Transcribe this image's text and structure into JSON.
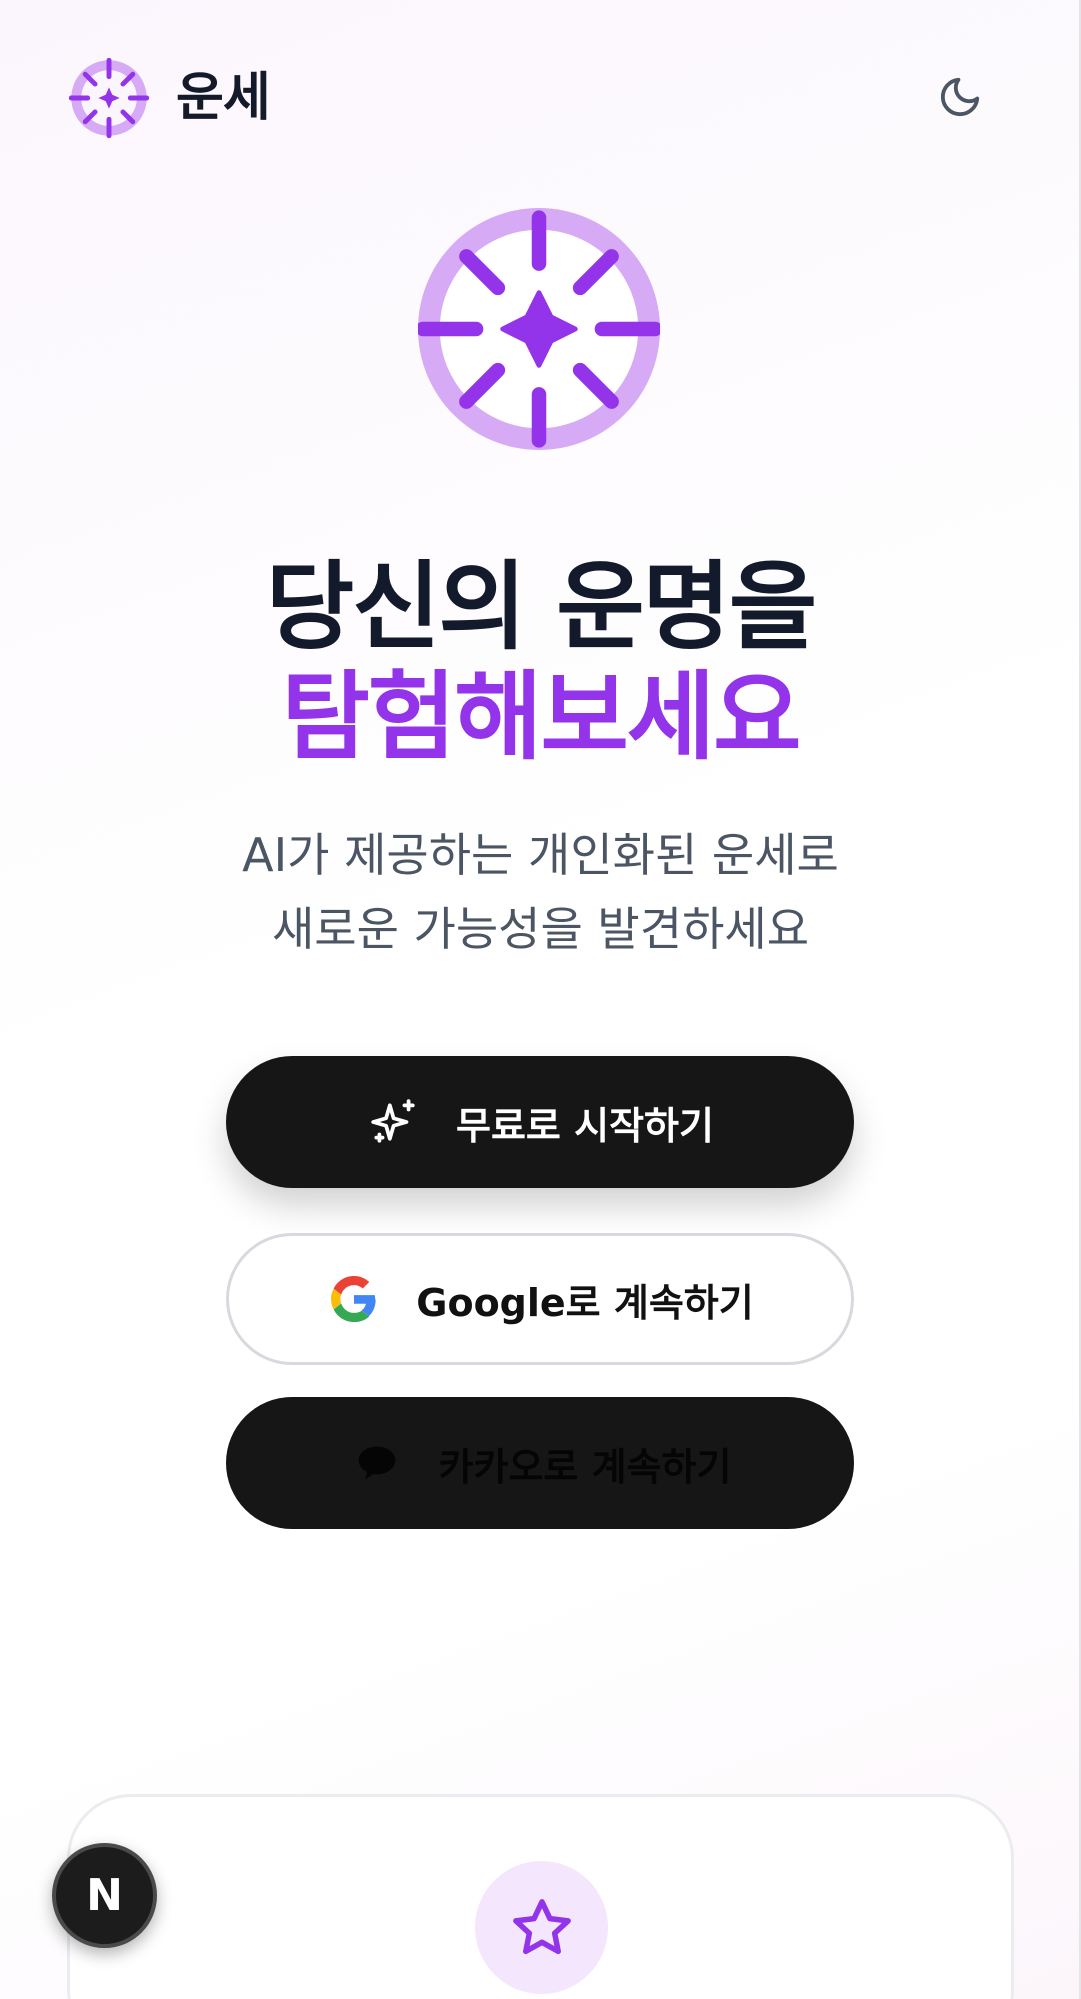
{
  "header": {
    "brand": "운세",
    "logo_icon": "sparkle-compass-icon",
    "theme_toggle_icon": "moon-icon"
  },
  "hero": {
    "icon": "sparkle-compass-icon",
    "headline_line1": "당신의 운명을",
    "headline_line2": "탐험해보세요",
    "subtitle_line1": "AI가 제공하는 개인화된 운세로",
    "subtitle_line2": "새로운 가능성을 발견하세요"
  },
  "buttons": {
    "start": {
      "label": "무료로 시작하기",
      "icon": "sparkles-icon"
    },
    "google": {
      "label": "Google로 계속하기",
      "icon": "google-logo-icon"
    },
    "kakao": {
      "label": "카카오로 계속하기",
      "icon": "chat-bubble-icon"
    }
  },
  "feature_card": {
    "icon": "star-icon"
  },
  "floating_badge": {
    "label": "N"
  },
  "colors": {
    "accent": "#9333ea",
    "accent_light": "#d6aaf5",
    "dark": "#161616",
    "text": "#131a2b",
    "muted": "#4b5563"
  }
}
